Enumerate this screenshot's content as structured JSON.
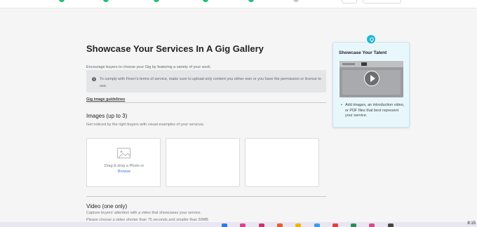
{
  "page": {
    "title": "Showcase Your Services In A Gig Gallery",
    "subtitle": "Encourage buyers to choose your Gig by featuring a variety of your work.",
    "notice_text": "To comply with Fiverr's terms of service, make sure to upload only content you either own or you have the permission or license to use.",
    "guidelines_link": "Gig image guidelines"
  },
  "images_section": {
    "title": "Images (up to 3)",
    "subtitle": "Get noticed by the right buyers with visual examples of your services.",
    "drag_text": "Drag & drop a Photo or",
    "browse_label": "Browse"
  },
  "video_section": {
    "title": "Video (one only)",
    "subtitle": "Capture buyers' attention with a video that showcases your service.",
    "note": "Please choose a video shorter than 75 seconds and smaller than 50MB"
  },
  "help_card": {
    "title": "Showcase Your Talent",
    "bullet": "Add images, an introduction video, or PDF files that best represent your service."
  },
  "taskbar": {
    "clock": "8:15"
  },
  "colors": {
    "accent_green": "#1dbf73",
    "link_blue": "#446ee7",
    "help_bg": "#e8f7fb",
    "bulb": "#22b8d3"
  }
}
